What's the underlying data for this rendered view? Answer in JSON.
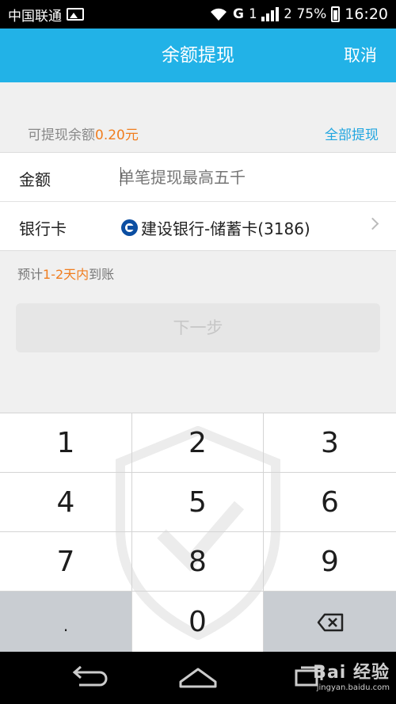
{
  "status_bar": {
    "carrier": "中国联通",
    "network": "G",
    "sim1": "1",
    "sim2": "2",
    "battery_percent": "75%",
    "time": "16:20",
    "icons": [
      "image-icon",
      "wifi-icon",
      "signal-icon",
      "battery-icon"
    ]
  },
  "header": {
    "title": "余额提现",
    "cancel_label": "取消",
    "background_color": "#22b2e7"
  },
  "balance": {
    "label": "可提现余额",
    "amount": "0.20元",
    "withdraw_all_label": "全部提现"
  },
  "form": {
    "amount_label": "金额",
    "amount_placeholder": "单笔提现最高五千",
    "card_label": "银行卡",
    "card_value": "建设银行-储蓄卡(3186)",
    "card_icon": "ccb-bank-icon"
  },
  "eta": {
    "prefix": "预计",
    "highlight": "1-2天内",
    "suffix": "到账"
  },
  "next_button_label": "下一步",
  "keypad": {
    "keys": [
      "1",
      "2",
      "3",
      "4",
      "5",
      "6",
      "7",
      "8",
      "9",
      ".",
      "0"
    ],
    "backspace_icon": "backspace-icon",
    "watermark_icon": "shield-check-icon"
  },
  "nav_bar": {
    "icons": [
      "back-icon",
      "home-icon",
      "recents-icon"
    ]
  },
  "watermark": {
    "line1": "Bai 经验",
    "line2": "jingyan.baidu.com"
  },
  "colors": {
    "accent": "#22b2e7",
    "highlight": "#f07d1f",
    "link": "#22a6e0"
  }
}
